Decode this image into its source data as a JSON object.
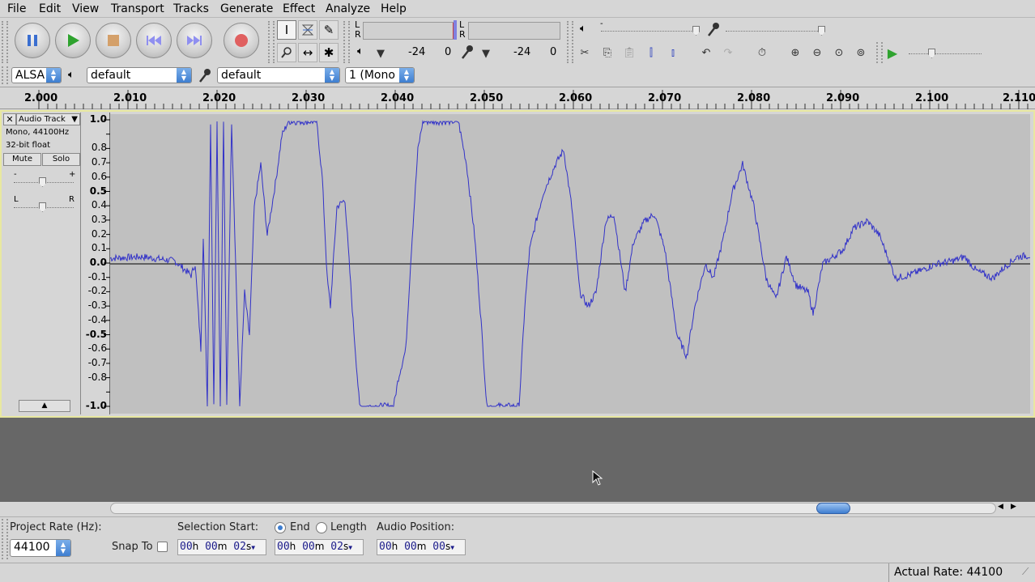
{
  "menu": [
    "File",
    "Edit",
    "View",
    "Transport",
    "Tracks",
    "Generate",
    "Effect",
    "Analyze",
    "Help"
  ],
  "transport": {
    "pause": "pause-icon",
    "play": "play-icon",
    "stop": "stop-icon",
    "skip_start": "skip-to-start-icon",
    "skip_end": "skip-to-end-icon",
    "record": "record-icon"
  },
  "meters": {
    "play_L": "L",
    "play_R": "R",
    "rec_L": "L",
    "rec_R": "R",
    "play_db_min": "-24",
    "play_db_zero": "0",
    "rec_db_min": "-24",
    "rec_db_zero": "0"
  },
  "mixer": {
    "vol_min": "-",
    "vol_max": "+"
  },
  "device": {
    "host": "ALSA",
    "playback": "default",
    "recording": "default",
    "channels": "1 (Mono"
  },
  "ruler": {
    "labels": [
      "2.000",
      "2.010",
      "2.020",
      "2.030",
      "2.040",
      "2.050",
      "2.060",
      "2.070",
      "2.080",
      "2.090",
      "2.100",
      "2.110"
    ]
  },
  "track": {
    "name": "Audio Track",
    "format": "Mono, 44100Hz",
    "bitdepth": "32-bit float",
    "mute": "Mute",
    "solo": "Solo",
    "gain_min": "-",
    "gain_max": "+",
    "pan_left": "L",
    "pan_right": "R",
    "vscale": [
      "1.0",
      "0.8",
      "0.7",
      "0.6",
      "0.5",
      "0.4",
      "0.3",
      "0.2",
      "0.1",
      "0.0",
      "-0.1",
      "-0.2",
      "-0.3",
      "-0.4",
      "-0.5",
      "-0.6",
      "-0.7",
      "-0.8",
      "-1.0"
    ]
  },
  "selection_bar": {
    "project_rate_label": "Project Rate (Hz):",
    "project_rate": "44100",
    "snap_to": "Snap To",
    "selection_start_label": "Selection Start:",
    "end_label": "End",
    "length_label": "Length",
    "audio_position_label": "Audio Position:",
    "start": {
      "h": "00",
      "m": "00",
      "s": "02"
    },
    "end": {
      "h": "00",
      "m": "00",
      "s": "02"
    },
    "position": {
      "h": "00",
      "m": "00",
      "s": "00"
    },
    "units": {
      "h": "h",
      "m": "m",
      "s": "s"
    }
  },
  "status": {
    "actual_rate": "Actual Rate: 44100"
  },
  "colors": {
    "waveform": "#3232c8",
    "wave_bg": "#c0c0c0",
    "empty": "#676767",
    "track_border": "#e8e8a0"
  }
}
